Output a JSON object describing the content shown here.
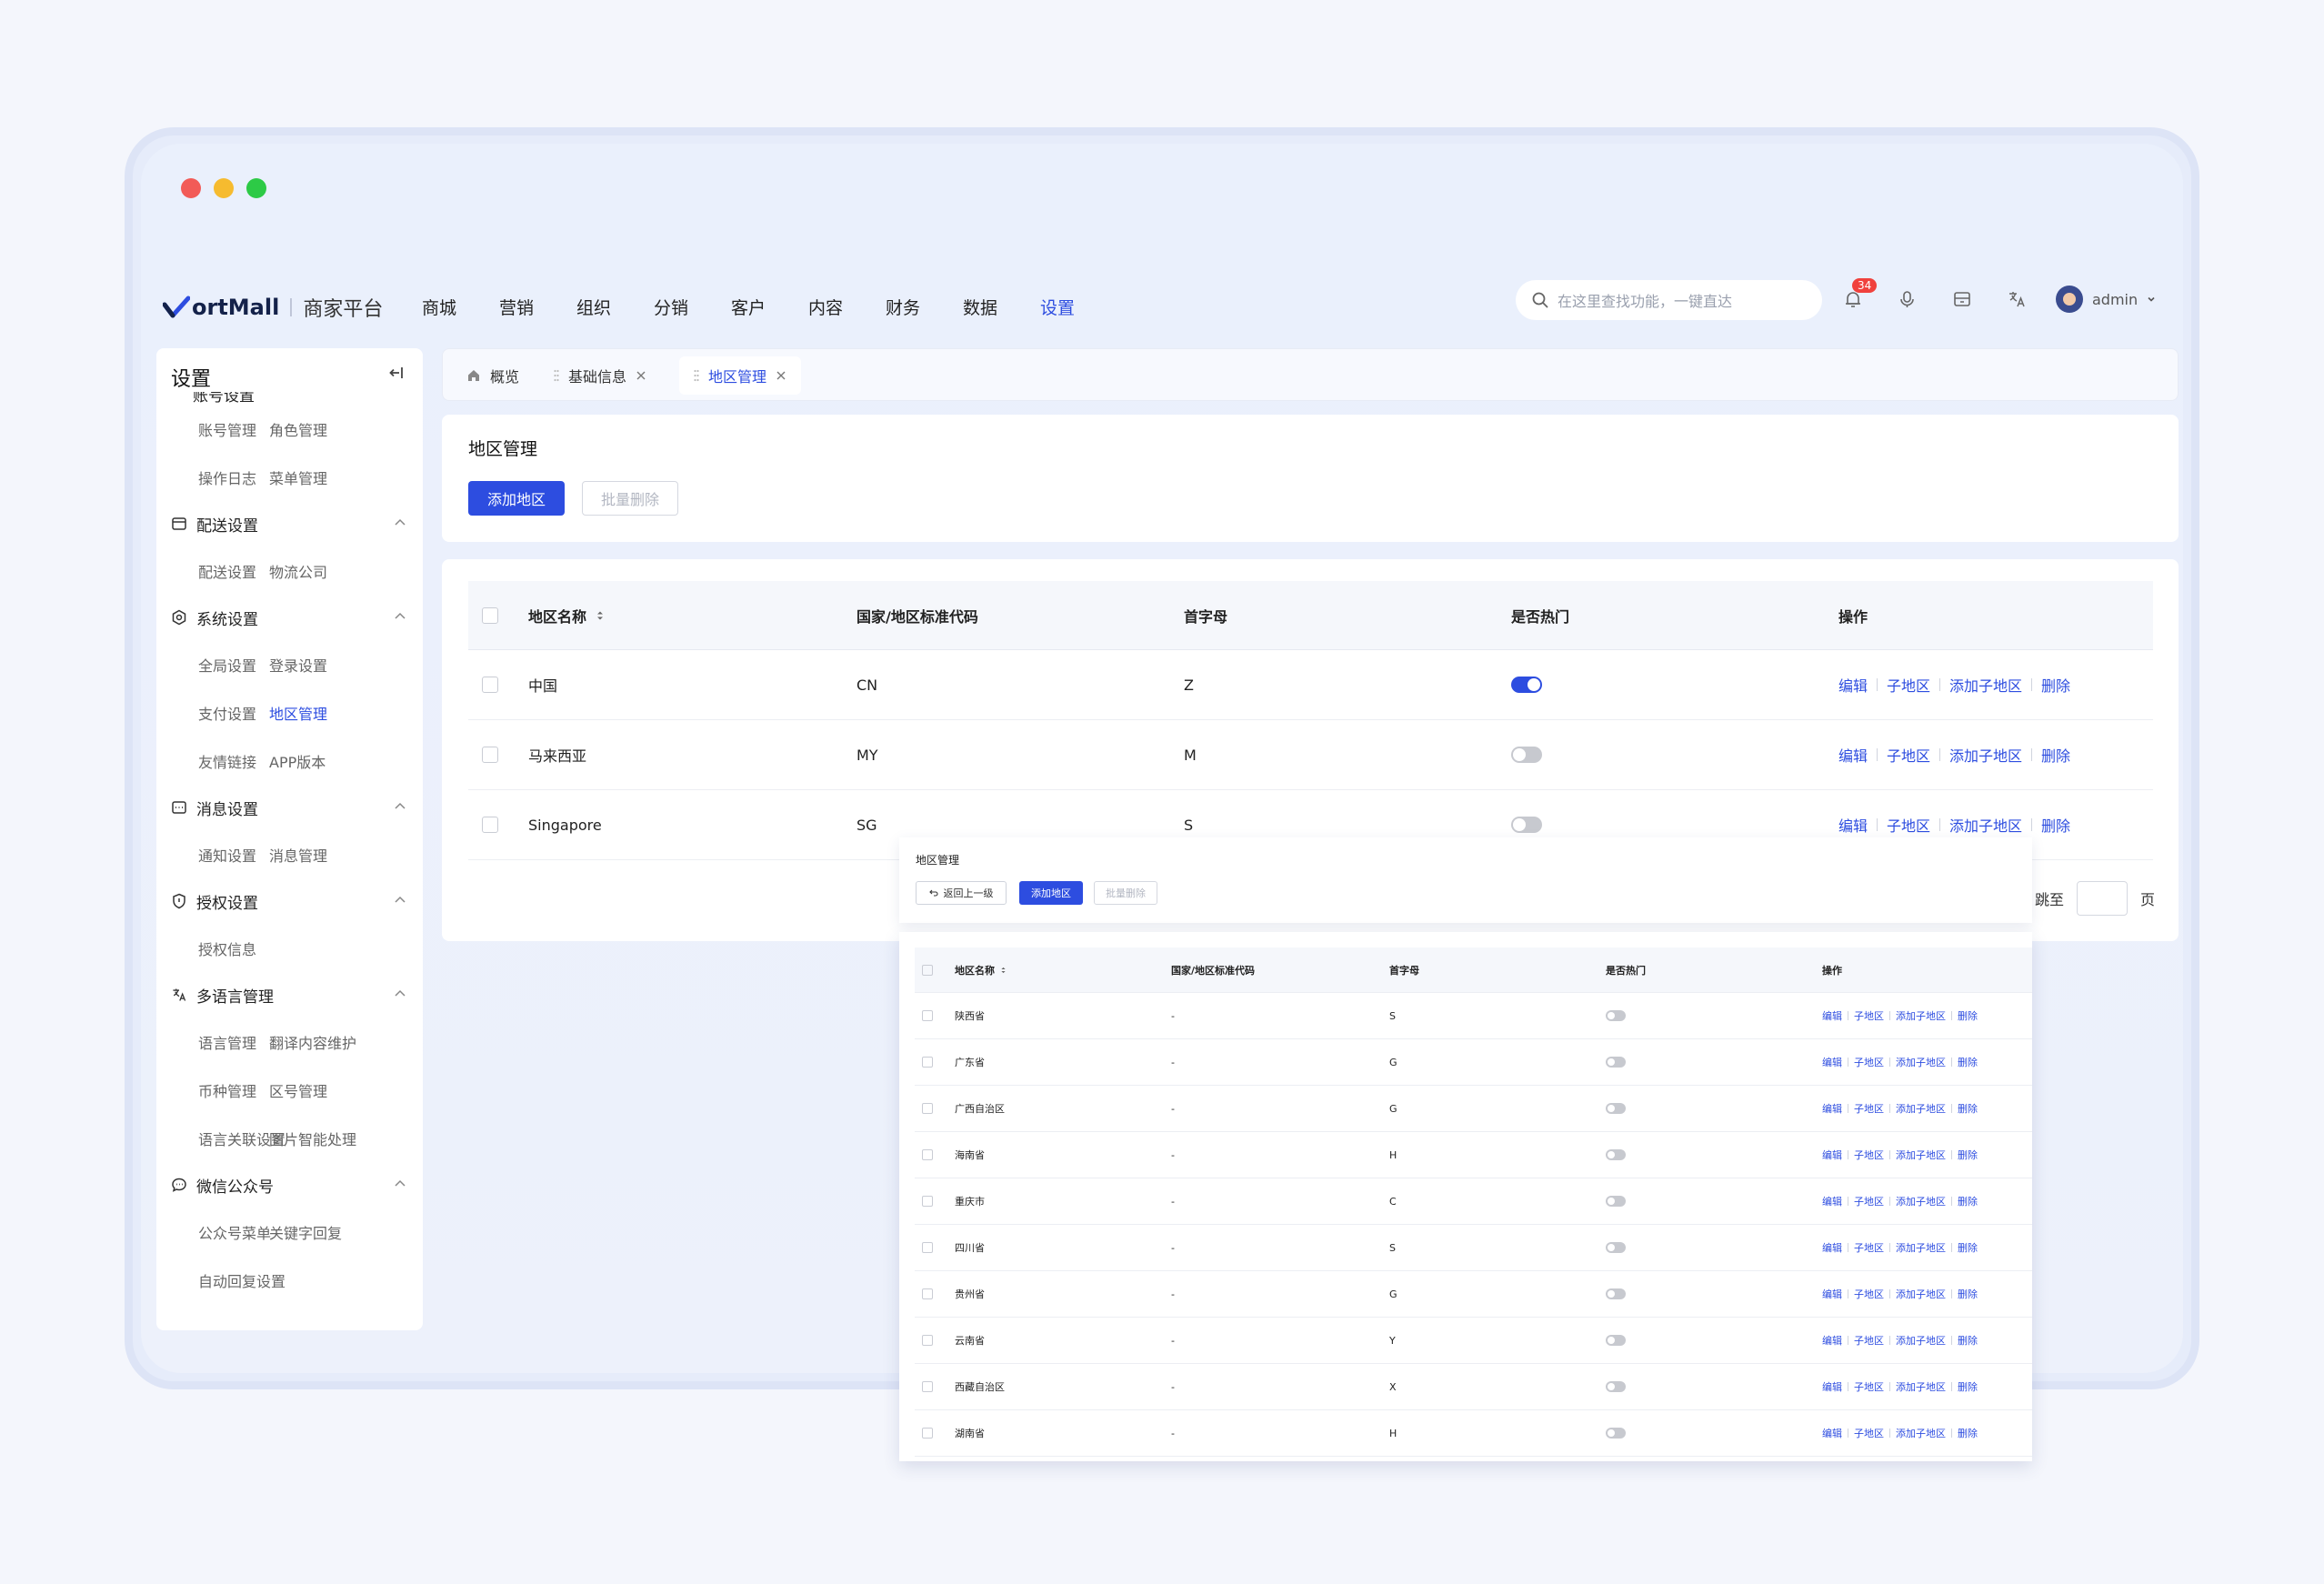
{
  "window_controls": {
    "close_color": "#f25b57",
    "minimize_color": "#f6bb2f",
    "maximize_color": "#2dca46"
  },
  "brand": {
    "name": "ortMall",
    "subtitle": "商家平台"
  },
  "top_menu": [
    {
      "label": "商城"
    },
    {
      "label": "营销"
    },
    {
      "label": "组织"
    },
    {
      "label": "分销"
    },
    {
      "label": "客户"
    },
    {
      "label": "内容"
    },
    {
      "label": "财务"
    },
    {
      "label": "数据"
    },
    {
      "label": "设置",
      "active": true
    }
  ],
  "search": {
    "placeholder": "在这里查找功能，一键直达"
  },
  "notifications": {
    "count": "34"
  },
  "user": {
    "name": "admin"
  },
  "sidebar": {
    "title": "设置",
    "truncated_group": "账号设置",
    "rows_top": [
      {
        "a": "账号管理",
        "b": "角色管理"
      },
      {
        "a": "操作日志",
        "b": "菜单管理"
      }
    ],
    "groups": [
      {
        "label": "配送设置",
        "rows": [
          {
            "a": "配送设置",
            "b": "物流公司"
          }
        ]
      },
      {
        "label": "系统设置",
        "rows": [
          {
            "a": "全局设置",
            "b": "登录设置"
          },
          {
            "a": "支付设置",
            "b": "地区管理",
            "active": "b"
          },
          {
            "a": "友情链接",
            "b": "APP版本"
          }
        ]
      },
      {
        "label": "消息设置",
        "rows": [
          {
            "a": "通知设置",
            "b": "消息管理"
          }
        ]
      },
      {
        "label": "授权设置",
        "rows": [
          {
            "a": "授权信息",
            "b": ""
          }
        ]
      },
      {
        "label": "多语言管理",
        "rows": [
          {
            "a": "语言管理",
            "b": "翻译内容维护"
          },
          {
            "a": "币种管理",
            "b": "区号管理"
          },
          {
            "a": "语言关联设置",
            "b": "图片智能处理"
          }
        ]
      },
      {
        "label": "微信公众号",
        "rows": [
          {
            "a": "公众号菜单",
            "b": "关键字回复"
          },
          {
            "a": "自动回复设置",
            "b": ""
          }
        ]
      }
    ]
  },
  "tabs": [
    {
      "label": "概览"
    },
    {
      "label": "基础信息"
    },
    {
      "label": "地区管理",
      "active": true
    }
  ],
  "page": {
    "title": "地区管理",
    "add_button": "添加地区",
    "batch_delete_button": "批量删除"
  },
  "table": {
    "headers": {
      "name": "地区名称",
      "code": "国家/地区标准代码",
      "initial": "首字母",
      "hot": "是否热门",
      "ops": "操作"
    },
    "ops_labels": {
      "edit": "编辑",
      "children": "子地区",
      "add_child": "添加子地区",
      "delete": "删除"
    },
    "rows": [
      {
        "name": "中国",
        "code": "CN",
        "initial": "Z",
        "hot": true
      },
      {
        "name": "马来西亚",
        "code": "MY",
        "initial": "M",
        "hot": false
      },
      {
        "name": "Singapore",
        "code": "SG",
        "initial": "S",
        "hot": false
      }
    ],
    "jump_label": "跳至",
    "page_label": "页"
  },
  "sub_page": {
    "title": "地区管理",
    "back_button": "返回上一级",
    "add_button": "添加地区",
    "batch_delete_button": "批量删除",
    "rows": [
      {
        "name": "陕西省",
        "code": "-",
        "initial": "S"
      },
      {
        "name": "广东省",
        "code": "-",
        "initial": "G"
      },
      {
        "name": "广西自治区",
        "code": "-",
        "initial": "G"
      },
      {
        "name": "海南省",
        "code": "-",
        "initial": "H"
      },
      {
        "name": "重庆市",
        "code": "-",
        "initial": "C"
      },
      {
        "name": "四川省",
        "code": "-",
        "initial": "S"
      },
      {
        "name": "贵州省",
        "code": "-",
        "initial": "G"
      },
      {
        "name": "云南省",
        "code": "-",
        "initial": "Y"
      },
      {
        "name": "西藏自治区",
        "code": "-",
        "initial": "X"
      },
      {
        "name": "湖南省",
        "code": "-",
        "initial": "H"
      }
    ]
  },
  "colors": {
    "accent": "#2d4de0",
    "badge": "#f0413d"
  }
}
